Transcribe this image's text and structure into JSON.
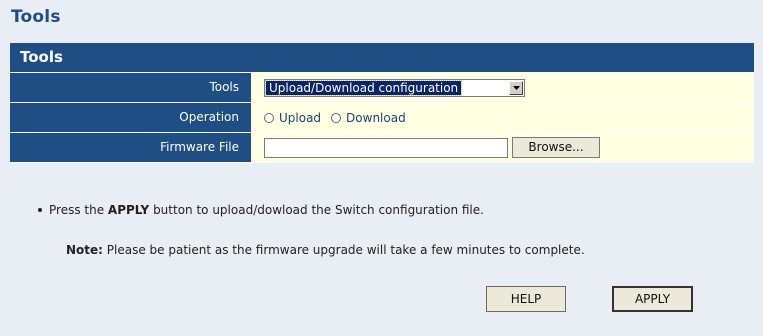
{
  "page": {
    "title": "Tools"
  },
  "panel": {
    "header": "Tools",
    "rows": {
      "tools": {
        "label": "Tools",
        "selected": "Upload/Download configuration"
      },
      "operation": {
        "label": "Operation",
        "options": [
          "Upload",
          "Download"
        ]
      },
      "firmware": {
        "label": "Firmware File",
        "value": "",
        "browse_label": "Browse..."
      }
    }
  },
  "instructions": {
    "bullet_pre": "Press the ",
    "bullet_bold": "APPLY",
    "bullet_post": " button to upload/dowload the Switch configuration file.",
    "note_bold": "Note:",
    "note_text": " Please be patient as the firmware upgrade will take a few minutes to complete."
  },
  "buttons": {
    "help": "HELP",
    "apply": "APPLY"
  },
  "icons": {
    "select_arrow": "chevron-down-icon"
  },
  "colors": {
    "header_bg": "#1f4e85",
    "value_bg": "#ffffe1",
    "page_bg": "#e9eef4"
  }
}
